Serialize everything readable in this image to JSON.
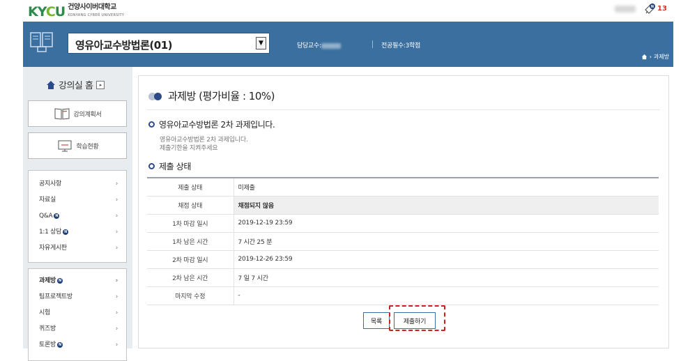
{
  "header": {
    "logo_mark_k": "K",
    "logo_mark_y": "Y",
    "logo_mark_c": "C",
    "logo_mark_u": "U",
    "logo_ko": "건양사이버대학교",
    "logo_en": "KONYANG CYBER UNIVERSITY",
    "message_count": "13",
    "message_badge": "N"
  },
  "course": {
    "selected": "영유아교수방법론(01)",
    "professor_label": "담당교수:",
    "credit": "전공필수:3학점",
    "breadcrumb_current": "과제방"
  },
  "sidebar": {
    "home_label": "강의실 홈",
    "home_go": "▸",
    "syllabus_label": "강의계획서",
    "progress_label": "학습현황",
    "group1": [
      {
        "label": "공지사항",
        "badge": ""
      },
      {
        "label": "자료실",
        "badge": ""
      },
      {
        "label": "Q&A",
        "badge": "N"
      },
      {
        "label": "1:1 상담",
        "badge": "N"
      },
      {
        "label": "자유게시판",
        "badge": ""
      }
    ],
    "group2": [
      {
        "label": "과제방",
        "badge": "N"
      },
      {
        "label": "팀프로젝트방",
        "badge": ""
      },
      {
        "label": "시험",
        "badge": ""
      },
      {
        "label": "퀴즈방",
        "badge": ""
      },
      {
        "label": "토론방",
        "badge": "N"
      }
    ]
  },
  "main": {
    "title": "과제방 (평가비율 : 10%)",
    "assignment_heading": "영유아교수방법론 2차 과제입니다.",
    "desc_line1": "영유아교수방법론 2차 과제입니다.",
    "desc_line2": "제출기한을 지켜주세요",
    "status_heading": "제출 상태",
    "rows": [
      {
        "key": "제출 상태",
        "value": "미제출"
      },
      {
        "key": "채점 상태",
        "value": "채점되지 않음"
      },
      {
        "key": "1차 마감 일시",
        "value": "2019-12-19 23:59"
      },
      {
        "key": "1차 남은 시간",
        "value": "7 시간 25 분"
      },
      {
        "key": "2차 마감 일시",
        "value": "2019-12-26 23:59"
      },
      {
        "key": "2차 남은 시간",
        "value": "7 일 7 시간"
      },
      {
        "key": "마지막 수정",
        "value": "-"
      }
    ],
    "list_button": "목록",
    "submit_button": "제출하기"
  },
  "colors": {
    "header_blue": "#3a6f9f",
    "accent_navy": "#2b4a8a",
    "highlight_red": "#d0201c",
    "logo_green": "#2c8a4a"
  },
  "icons": [
    "book-icon",
    "home-icon",
    "chevron-right-icon",
    "message-icon",
    "syllabus-book-icon",
    "monitor-icon"
  ]
}
